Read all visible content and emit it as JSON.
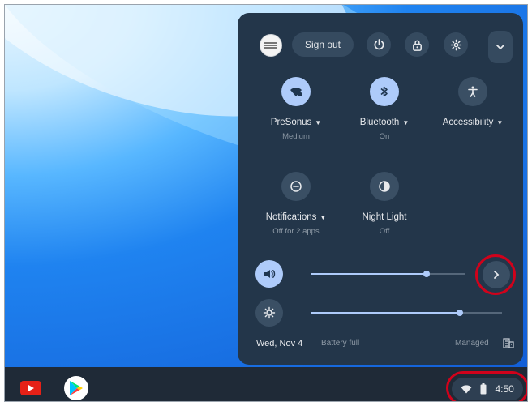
{
  "header": {
    "signout_label": "Sign out"
  },
  "tiles": [
    {
      "label": "PreSonus",
      "sub": "Medium",
      "icon": "wifi-icon",
      "active": true
    },
    {
      "label": "Bluetooth",
      "sub": "On",
      "icon": "bluetooth-icon",
      "active": true
    },
    {
      "label": "Accessibility",
      "sub": "",
      "icon": "accessibility-icon",
      "active": false
    },
    {
      "label": "Notifications",
      "sub": "Off for 2 apps",
      "icon": "notifications-off-icon",
      "active": false
    },
    {
      "label": "Night Light",
      "sub": "Off",
      "icon": "night-light-icon",
      "active": false
    }
  ],
  "sliders": {
    "volume_level": 0.75,
    "brightness_level": 0.78
  },
  "footer": {
    "date": "Wed, Nov 4",
    "battery": "Battery full",
    "managed": "Managed"
  },
  "shelf": {
    "time": "4:50",
    "apps": [
      "youtube-icon",
      "play-store-icon"
    ]
  },
  "colors": {
    "panel": "#23364a",
    "accent": "#aecbfa",
    "highlight_ring": "#d0021b"
  }
}
